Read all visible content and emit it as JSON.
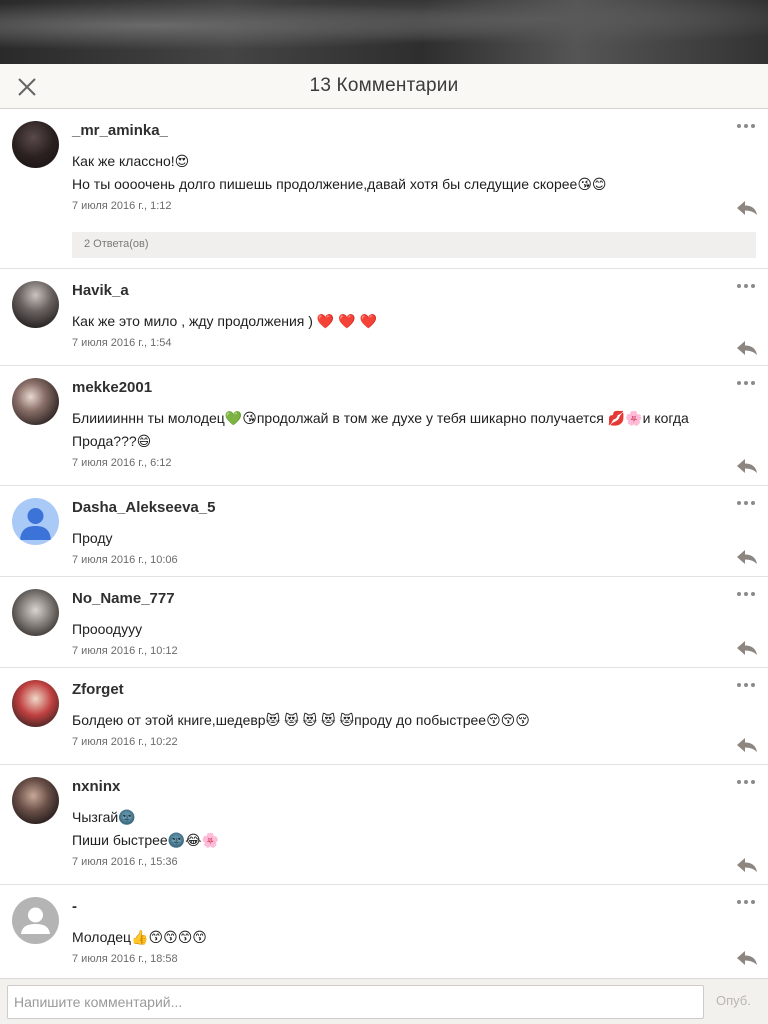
{
  "header": {
    "title": "13 Комментарии"
  },
  "comments": [
    {
      "username": "_mr_aminka_",
      "lines": [
        "Как же классно!😍",
        "Но ты оооочень долго пишешь продолжение,давай хотя бы следущие скорее😘😊"
      ],
      "date": "7 июля 2016 г., 1:12",
      "replies_label": "2 Ответа(ов)"
    },
    {
      "username": "Havik_a",
      "lines": [
        "Как же это мило , жду продолжения ) ❤️ ❤️ ❤️"
      ],
      "date": "7 июля 2016 г., 1:54"
    },
    {
      "username": "mekke2001",
      "lines": [
        "Блииииннн ты молодец💚😘продолжай в том же духе у тебя шикарно получается 💋🌸и когда",
        "Прода???😄"
      ],
      "date": "7 июля 2016 г., 6:12"
    },
    {
      "username": "Dasha_Alekseeva_5",
      "lines": [
        "Проду"
      ],
      "date": "7 июля 2016 г., 10:06"
    },
    {
      "username": "No_Name_777",
      "lines": [
        "Прооодууу"
      ],
      "date": "7 июля 2016 г., 10:12"
    },
    {
      "username": "Zforget",
      "lines": [
        "Болдею от этой книге,шедевр😻 😻 😻 😻 😻проду до побыстрее😚😚😚"
      ],
      "date": "7 июля 2016 г., 10:22"
    },
    {
      "username": "nxninx",
      "lines": [
        "Чызгай🌚",
        "Пиши быстрее🌚😂🌸"
      ],
      "date": "7 июля 2016 г., 15:36"
    },
    {
      "username": "-",
      "lines": [
        "Молодец👍😙😙😙😙"
      ],
      "date": "7 июля 2016 г., 18:58"
    }
  ],
  "composer": {
    "placeholder": "Напишите комментарий...",
    "post_label": "Опуб."
  },
  "colors": {
    "header_bg": "#faf8f5",
    "reply_icon": "#8c8580",
    "divider": "#e4e1de"
  }
}
